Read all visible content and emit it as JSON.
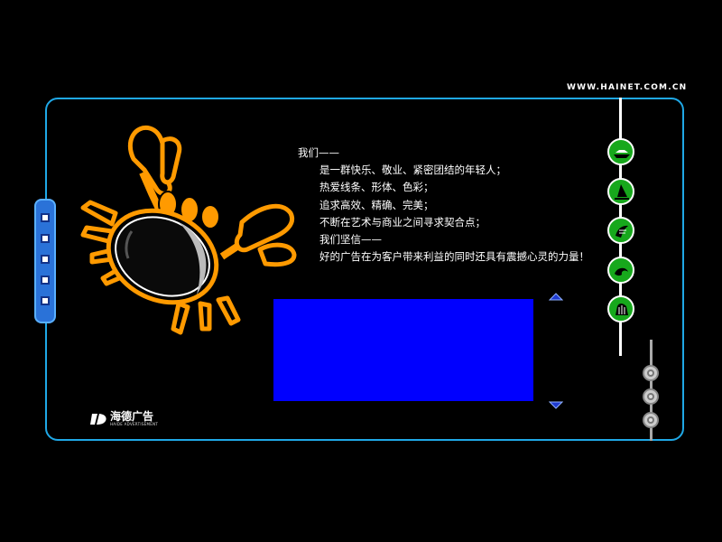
{
  "header": {
    "url": "WWW.HAINET.COM.CN"
  },
  "content": {
    "lines": [
      "我们——",
      "是一群快乐、敬业、紧密团结的年轻人；",
      "热爱线条、形体、色彩；",
      "追求高效、精确、完美；",
      "不断在艺术与商业之间寻求契合点；",
      "我们坚信——",
      "好的广告在为客户带来利益的同时还具有震撼心灵的力量！"
    ]
  },
  "logo": {
    "name": "海德广告",
    "sub": "HAIDE ADVERTISEMENT"
  },
  "nav": {
    "icons": [
      "boat-icon",
      "sail-icon",
      "hand-icon",
      "wave-icon",
      "shell-icon"
    ]
  },
  "colors": {
    "frame": "#1fa8e6",
    "panel": "#0000ff",
    "nav_button": "#17a81c",
    "crab_orange": "#ff9a00"
  }
}
